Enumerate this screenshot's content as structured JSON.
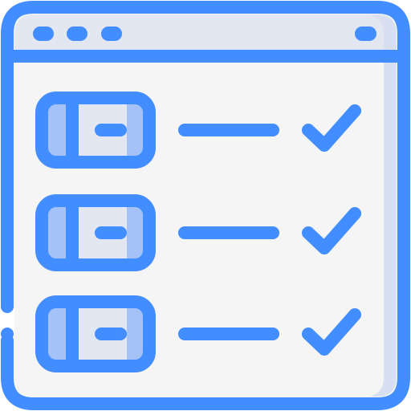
{
  "icon": {
    "name": "browser-checklist-icon",
    "colors": {
      "stroke": "#428DFF",
      "window_fill": "#F5F5F5",
      "header_fill": "#E3E7F2",
      "side_shade": "#D8DFF0",
      "toggle_fill": "#A4C2F7",
      "toggle_highlight": "#E3E7F2",
      "background": "#FFFFFF"
    },
    "checklist": {
      "items": [
        {
          "name": "checklist-item-1",
          "checked": true
        },
        {
          "name": "checklist-item-2",
          "checked": true
        },
        {
          "name": "checklist-item-3",
          "checked": true
        }
      ]
    }
  }
}
